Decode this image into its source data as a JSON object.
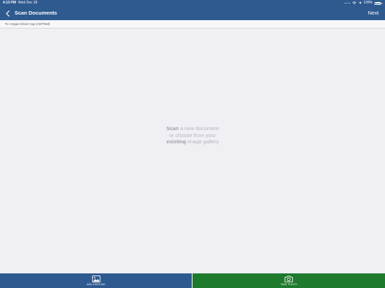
{
  "status_bar": {
    "time": "4:13 PM",
    "date": "Wed Dec 18",
    "battery": "100%"
  },
  "nav": {
    "title": "Scan Documents",
    "next_label": "Next"
  },
  "recipient": {
    "text": "To: Hogan Driver App (HDTNM)"
  },
  "empty_state": {
    "line1_bold": "Scan",
    "line1_rest": " a new document",
    "line2": "or choose from your",
    "line3_bold": "existing",
    "line3_rest": " image gallery"
  },
  "bottom_bar": {
    "add_existing_label": "ADD EXISTING",
    "take_photo_label": "TAKE PHOTO"
  },
  "colors": {
    "nav_blue": "#2e5a8f",
    "take_photo_green": "#1e7a2c",
    "background": "#efeff4"
  },
  "icons": {
    "back": "chevron-left-icon",
    "wifi": "wifi-icon",
    "location": "location-arrow-icon",
    "battery": "battery-icon",
    "gallery": "image-gallery-icon",
    "camera": "camera-icon"
  }
}
